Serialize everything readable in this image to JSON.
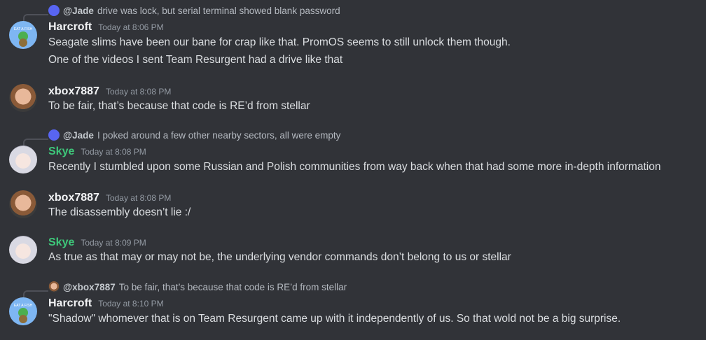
{
  "messages": [
    {
      "reply": {
        "mention": "@Jade",
        "text": "drive was lock, but serial terminal showed blank password"
      },
      "author": "Harcroft",
      "time": "Today at 8:06 PM",
      "lines": [
        "Seagate slims have been our bane for crap like that. PromOS seems to still unlock them though.",
        "One of the videos I sent Team Resurgent had a drive like that"
      ],
      "avatar_text": "EAT A FISH"
    },
    {
      "author": "xbox7887",
      "time": "Today at 8:08 PM",
      "lines": [
        "To be fair, that’s because that code is RE’d from stellar"
      ]
    },
    {
      "reply": {
        "mention": "@Jade",
        "text": "I poked around a few other nearby sectors, all were empty"
      },
      "author": "Skye",
      "time": "Today at 8:08 PM",
      "lines": [
        "Recently I stumbled upon some Russian and Polish communities from way back when that had some more in-depth information"
      ]
    },
    {
      "author": "xbox7887",
      "time": "Today at 8:08 PM",
      "lines": [
        "The disassembly doesn’t lie :/"
      ]
    },
    {
      "author": "Skye",
      "time": "Today at 8:09 PM",
      "lines": [
        "As true as that may or may not be, the underlying vendor commands don’t belong to us or stellar"
      ]
    },
    {
      "reply": {
        "mention": "@xbox7887",
        "text": "To be fair, that’s because that code is RE’d from stellar"
      },
      "author": "Harcroft",
      "time": "Today at 8:10 PM",
      "lines": [
        "\"Shadow\" whomever that is on Team Resurgent came up with it independently of us. So that wold not be a big surprise."
      ]
    }
  ],
  "colors": {
    "background": "#313338",
    "skye": "#3ec77a",
    "discord_blurple": "#5865f2"
  }
}
